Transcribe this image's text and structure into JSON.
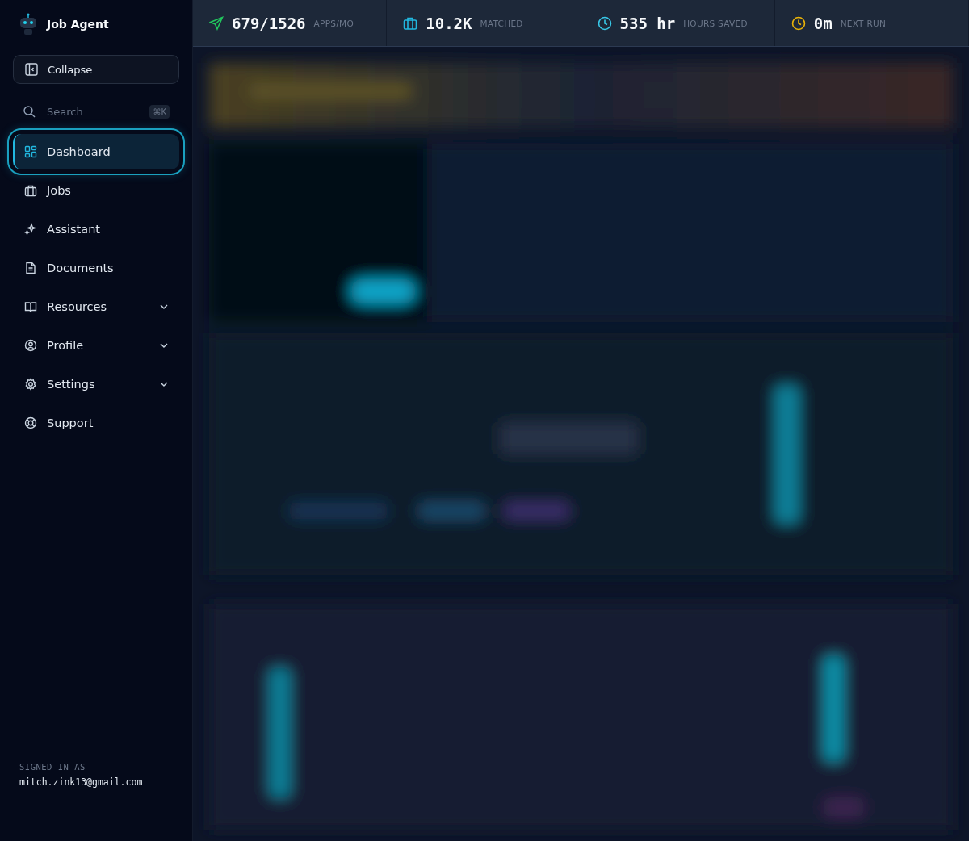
{
  "brand": {
    "name": "Job Agent"
  },
  "collapse_button": {
    "label": "Collapse"
  },
  "search": {
    "placeholder": "Search",
    "shortcut": "⌘K"
  },
  "nav": [
    {
      "label": "Dashboard",
      "kind": "dashboard",
      "selected": true,
      "expandable": false
    },
    {
      "label": "Jobs",
      "kind": "jobs",
      "selected": false,
      "expandable": false
    },
    {
      "label": "Assistant",
      "kind": "assistant",
      "selected": false,
      "expandable": false
    },
    {
      "label": "Documents",
      "kind": "documents",
      "selected": false,
      "expandable": false
    },
    {
      "label": "Resources",
      "kind": "resources",
      "selected": false,
      "expandable": true
    },
    {
      "label": "Profile",
      "kind": "profile",
      "selected": false,
      "expandable": true
    },
    {
      "label": "Settings",
      "kind": "settings",
      "selected": false,
      "expandable": true
    },
    {
      "label": "Support",
      "kind": "support",
      "selected": false,
      "expandable": false
    }
  ],
  "account": {
    "caption": "SIGNED IN AS",
    "email": "mitch.zink13@gmail.com"
  },
  "stats": [
    {
      "kind": "send",
      "value": "679/1526",
      "label": "APPS/MO",
      "color": "#22c55e"
    },
    {
      "kind": "briefcase",
      "value": "10.2K",
      "label": "MATCHED",
      "color": "#22b8e0"
    },
    {
      "kind": "clock",
      "value": "535 hr",
      "label": "HOURS SAVED",
      "color": "#38c8e8"
    },
    {
      "kind": "clock",
      "value": "0m",
      "label": "NEXT RUN",
      "color": "#eab308"
    }
  ]
}
